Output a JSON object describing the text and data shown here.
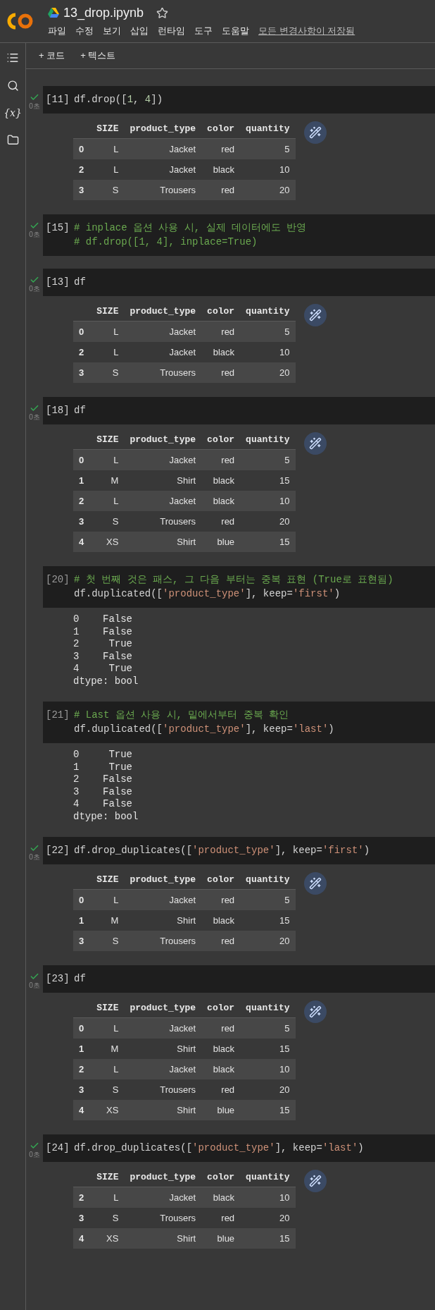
{
  "header": {
    "title": "13_drop.ipynb",
    "menus": [
      "파일",
      "수정",
      "보기",
      "삽입",
      "런타임",
      "도구",
      "도움말"
    ],
    "save_status": "모든 변경사항이 저장됨"
  },
  "toolbar": [
    "+ 코드",
    "+ 텍스트"
  ],
  "sidebar": {
    "variables_label": "{x}"
  },
  "cells": [
    {
      "number": "[11]",
      "executed": true,
      "time": "0초",
      "code": [
        [
          {
            "kind": "plain",
            "text": "df.drop(["
          },
          {
            "kind": "number",
            "text": "1"
          },
          {
            "kind": "plain",
            "text": ", "
          },
          {
            "kind": "number",
            "text": "4"
          },
          {
            "kind": "plain",
            "text": "])"
          }
        ]
      ],
      "output": {
        "kind": "table",
        "columns": [
          "",
          "SIZE",
          "product_type",
          "color",
          "quantity"
        ],
        "rows": [
          [
            "0",
            "L",
            "Jacket",
            "red",
            "5"
          ],
          [
            "2",
            "L",
            "Jacket",
            "black",
            "10"
          ],
          [
            "3",
            "S",
            "Trousers",
            "red",
            "20"
          ]
        ]
      }
    },
    {
      "number": "[15]",
      "executed": true,
      "time": "0초",
      "code": [
        [
          {
            "kind": "comment",
            "text": "# inplace 옵션 사용 시, 실제 데이터에도 반영"
          }
        ],
        [
          {
            "kind": "comment",
            "text": "# df.drop([1, 4], inplace=True)"
          }
        ]
      ]
    },
    {
      "number": "[13]",
      "executed": true,
      "time": "0초",
      "code": [
        [
          {
            "kind": "plain",
            "text": "df"
          }
        ]
      ],
      "output": {
        "kind": "table",
        "columns": [
          "",
          "SIZE",
          "product_type",
          "color",
          "quantity"
        ],
        "rows": [
          [
            "0",
            "L",
            "Jacket",
            "red",
            "5"
          ],
          [
            "2",
            "L",
            "Jacket",
            "black",
            "10"
          ],
          [
            "3",
            "S",
            "Trousers",
            "red",
            "20"
          ]
        ]
      }
    },
    {
      "number": "[18]",
      "executed": true,
      "time": "0초",
      "code": [
        [
          {
            "kind": "plain",
            "text": "df"
          }
        ]
      ],
      "output": {
        "kind": "table",
        "columns": [
          "",
          "SIZE",
          "product_type",
          "color",
          "quantity"
        ],
        "rows": [
          [
            "0",
            "L",
            "Jacket",
            "red",
            "5"
          ],
          [
            "1",
            "M",
            "Shirt",
            "black",
            "15"
          ],
          [
            "2",
            "L",
            "Jacket",
            "black",
            "10"
          ],
          [
            "3",
            "S",
            "Trousers",
            "red",
            "20"
          ],
          [
            "4",
            "XS",
            "Shirt",
            "blue",
            "15"
          ]
        ]
      }
    },
    {
      "number": "[20]",
      "executed": false,
      "code": [
        [
          {
            "kind": "comment",
            "text": "# 첫 번째 것은 패스, 그 다음 부터는 중복 표현 (True로 표현됨)"
          }
        ],
        [
          {
            "kind": "plain",
            "text": "df.duplicated(["
          },
          {
            "kind": "string",
            "text": "'product_type'"
          },
          {
            "kind": "plain",
            "text": "], keep="
          },
          {
            "kind": "string",
            "text": "'first'"
          },
          {
            "kind": "plain",
            "text": ")"
          }
        ]
      ],
      "output": {
        "kind": "text",
        "lines": [
          "0    False",
          "1    False",
          "2     True",
          "3    False",
          "4     True",
          "dtype: bool"
        ]
      }
    },
    {
      "number": "[21]",
      "executed": false,
      "code": [
        [
          {
            "kind": "comment",
            "text": "# Last 옵션 사용 시, 밑에서부터 중복 확인"
          }
        ],
        [
          {
            "kind": "plain",
            "text": "df.duplicated(["
          },
          {
            "kind": "string",
            "text": "'product_type'"
          },
          {
            "kind": "plain",
            "text": "], keep="
          },
          {
            "kind": "string",
            "text": "'last'"
          },
          {
            "kind": "plain",
            "text": ")"
          }
        ]
      ],
      "output": {
        "kind": "text",
        "lines": [
          "0     True",
          "1     True",
          "2    False",
          "3    False",
          "4    False",
          "dtype: bool"
        ]
      }
    },
    {
      "number": "[22]",
      "executed": true,
      "time": "0초",
      "code": [
        [
          {
            "kind": "plain",
            "text": "df.drop_duplicates(["
          },
          {
            "kind": "string",
            "text": "'product_type'"
          },
          {
            "kind": "plain",
            "text": "], keep="
          },
          {
            "kind": "string",
            "text": "'first'"
          },
          {
            "kind": "plain",
            "text": ")"
          }
        ]
      ],
      "output": {
        "kind": "table",
        "columns": [
          "",
          "SIZE",
          "product_type",
          "color",
          "quantity"
        ],
        "rows": [
          [
            "0",
            "L",
            "Jacket",
            "red",
            "5"
          ],
          [
            "1",
            "M",
            "Shirt",
            "black",
            "15"
          ],
          [
            "3",
            "S",
            "Trousers",
            "red",
            "20"
          ]
        ]
      }
    },
    {
      "number": "[23]",
      "executed": true,
      "time": "0초",
      "code": [
        [
          {
            "kind": "plain",
            "text": "df"
          }
        ]
      ],
      "output": {
        "kind": "table",
        "columns": [
          "",
          "SIZE",
          "product_type",
          "color",
          "quantity"
        ],
        "rows": [
          [
            "0",
            "L",
            "Jacket",
            "red",
            "5"
          ],
          [
            "1",
            "M",
            "Shirt",
            "black",
            "15"
          ],
          [
            "2",
            "L",
            "Jacket",
            "black",
            "10"
          ],
          [
            "3",
            "S",
            "Trousers",
            "red",
            "20"
          ],
          [
            "4",
            "XS",
            "Shirt",
            "blue",
            "15"
          ]
        ]
      }
    },
    {
      "number": "[24]",
      "executed": true,
      "time": "0초",
      "code": [
        [
          {
            "kind": "plain",
            "text": "df.drop_duplicates(["
          },
          {
            "kind": "string",
            "text": "'product_type'"
          },
          {
            "kind": "plain",
            "text": "], keep="
          },
          {
            "kind": "string",
            "text": "'last'"
          },
          {
            "kind": "plain",
            "text": ")"
          }
        ]
      ],
      "output": {
        "kind": "table",
        "columns": [
          "",
          "SIZE",
          "product_type",
          "color",
          "quantity"
        ],
        "rows": [
          [
            "2",
            "L",
            "Jacket",
            "black",
            "10"
          ],
          [
            "3",
            "S",
            "Trousers",
            "red",
            "20"
          ],
          [
            "4",
            "XS",
            "Shirt",
            "blue",
            "15"
          ]
        ]
      }
    }
  ]
}
